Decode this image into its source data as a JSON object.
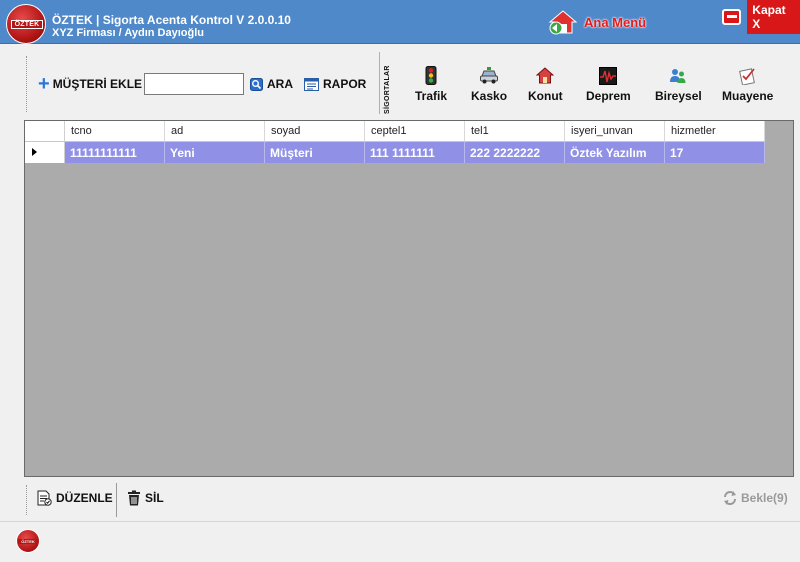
{
  "window": {
    "logo_text": "ÖZTEK",
    "title": "ÖZTEK | Sigorta Acenta Kontrol V 2.0.0.10",
    "subtitle": "XYZ Firması / Aydın Dayıoğlu",
    "home_label": "Ana Menü",
    "close_label": "Kapat X"
  },
  "toolbar": {
    "add_label": "MÜŞTERİ EKLE",
    "search_value": "",
    "search_label": "ARA",
    "report_label": "RAPOR",
    "group_label": "SİGORTALAR",
    "insurance_buttons": [
      {
        "label": "Trafik",
        "icon": "traffic-light-icon"
      },
      {
        "label": "Kasko",
        "icon": "car-icon"
      },
      {
        "label": "Konut",
        "icon": "house-icon"
      },
      {
        "label": "Deprem",
        "icon": "seismograph-icon"
      },
      {
        "label": "Bireysel",
        "icon": "users-icon"
      },
      {
        "label": "Muayene",
        "icon": "checklist-icon"
      }
    ]
  },
  "grid": {
    "columns": [
      "tcno",
      "ad",
      "soyad",
      "ceptel1",
      "tel1",
      "isyeri_unvan",
      "hizmetler"
    ],
    "rows": [
      [
        "11111111111",
        "Yeni",
        "Müşteri",
        "111 1111111",
        "222 2222222",
        "Öztek Yazılım",
        "17"
      ]
    ]
  },
  "bottom": {
    "edit_label": "DÜZENLE",
    "delete_label": "SİL",
    "wait_label": "Bekle(9)"
  },
  "footer": {
    "logo_text": "ÖZTEK"
  },
  "colors": {
    "titlebar": "#4f89c9",
    "accent_red": "#d81818",
    "row_selected": "#9090e6",
    "grid_background": "#ababab"
  }
}
